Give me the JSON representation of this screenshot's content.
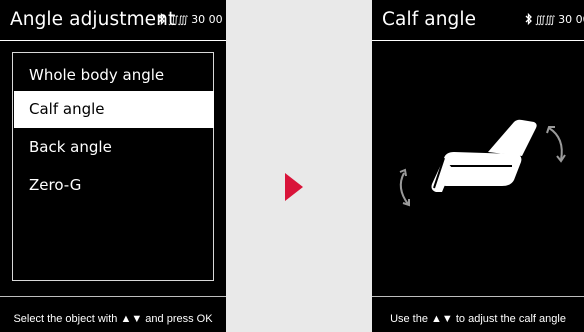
{
  "left_screen": {
    "title": "Angle adjustment",
    "status": {
      "heat_symbol": "∭∭",
      "value": "30 00"
    },
    "menu": [
      {
        "label": "Whole body angle",
        "selected": false
      },
      {
        "label": "Calf angle",
        "selected": true
      },
      {
        "label": "Back angle",
        "selected": false
      },
      {
        "label": "Zero-G",
        "selected": false
      }
    ],
    "hint": "Select the object with ▲▼ and press OK"
  },
  "right_screen": {
    "title": "Calf angle",
    "status": {
      "heat_symbol": "∭∭",
      "value": "30 00"
    },
    "hint": "Use the ▲▼ to adjust the calf angle"
  },
  "colors": {
    "screen_bg": "#000000",
    "page_bg": "#e9e9e9",
    "accent_arrow": "#d9143a",
    "selected_bg": "#ffffff"
  },
  "icons": [
    "bluetooth-icon",
    "heat-icon",
    "next-arrow-icon",
    "massage-chair-icon",
    "rotate-ccw-icon",
    "rotate-cw-icon"
  ]
}
